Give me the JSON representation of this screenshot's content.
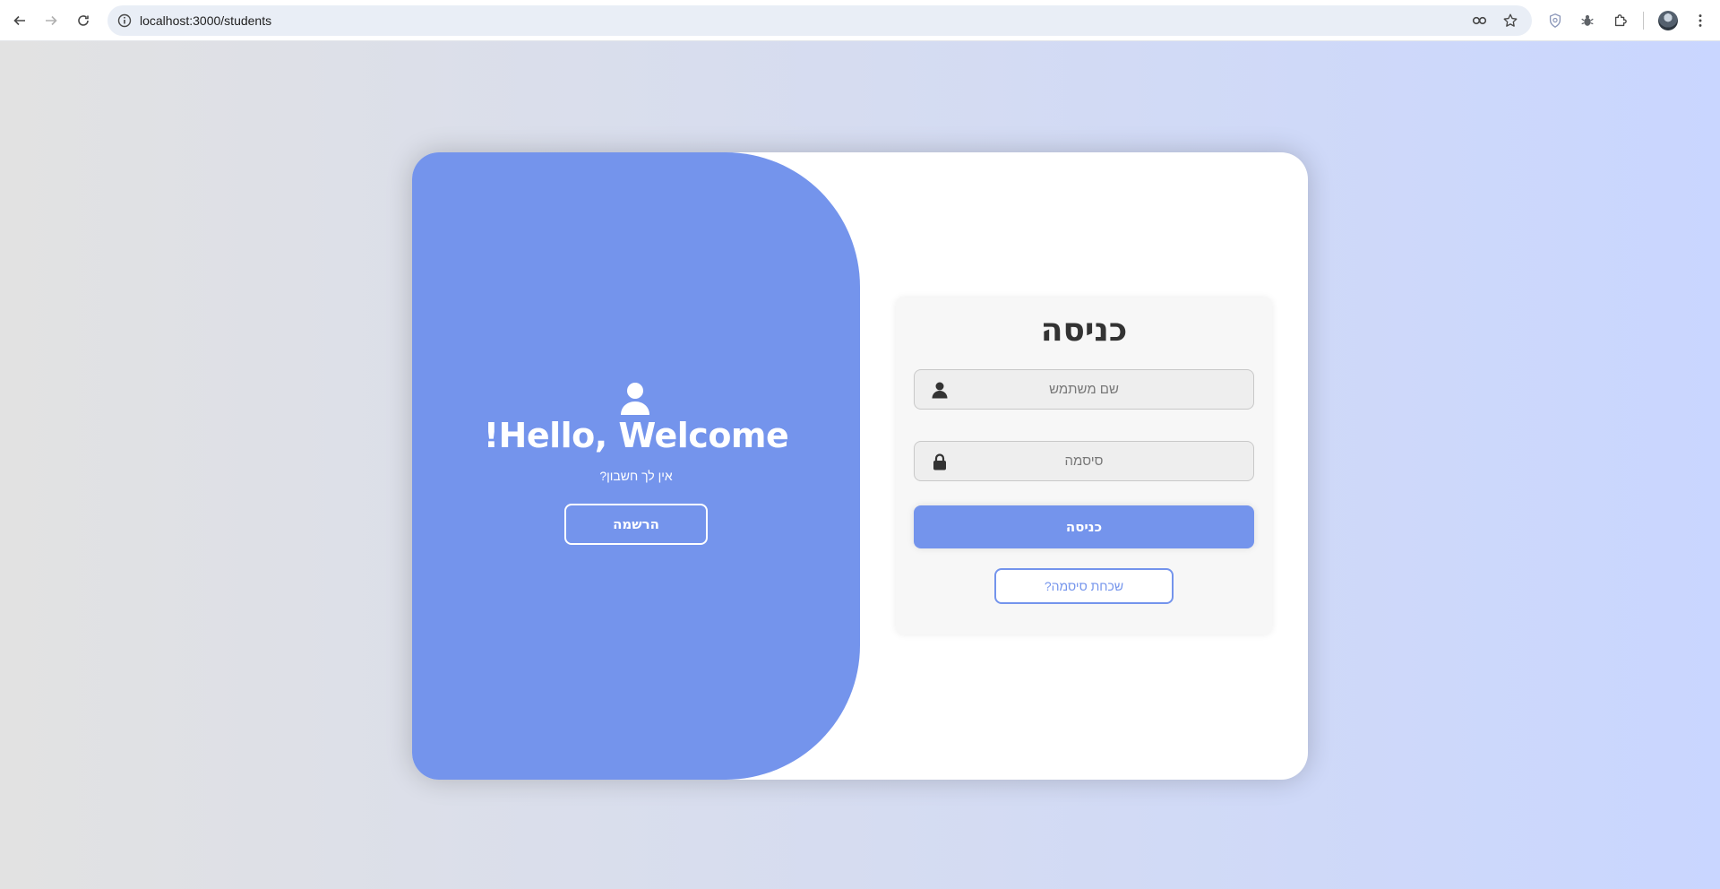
{
  "browser": {
    "url": "localhost:3000/students"
  },
  "welcome": {
    "title": "!Hello, Welcome",
    "subtitle": "אין לך חשבון?",
    "register_label": "הרשמה"
  },
  "login": {
    "title": "כניסה",
    "username_placeholder": "שם משתמש",
    "password_placeholder": "סיסמה",
    "submit_label": "כניסה",
    "forgot_label": "שכחת סיסמה?"
  },
  "colors": {
    "accent": "#7494ec",
    "background_start": "#e2e2e2",
    "background_end": "#c9d6ff"
  }
}
